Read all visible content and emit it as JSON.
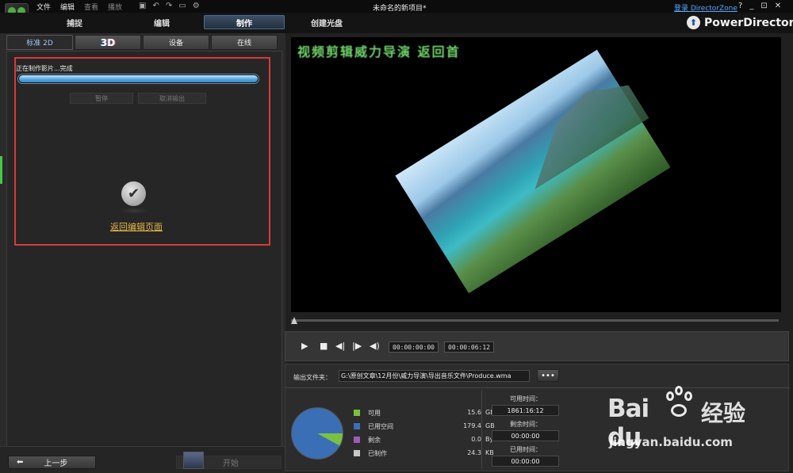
{
  "menu": {
    "items": [
      "文件",
      "编辑",
      "查看",
      "播放"
    ]
  },
  "window": {
    "title": "未命名的新项目*",
    "signin": "登录 DirectorZone",
    "help": "?",
    "minimize": "_",
    "restore": "⊡",
    "close": "✕"
  },
  "modes": {
    "capture": "捕捉",
    "edit": "编辑",
    "produce": "制作",
    "disc": "创建光盘"
  },
  "brand": {
    "name": "PowerDirector"
  },
  "subtabs": {
    "standard2d": "标准 2D",
    "threed": "3D",
    "device": "设备",
    "online": "在线"
  },
  "produce": {
    "status": "正在制作影片...完成",
    "progress": 1.0,
    "pause": "暂停",
    "cancel": "取消输出",
    "return_link": "返回编辑页面"
  },
  "nav": {
    "prev": "上一步",
    "start": "开始"
  },
  "preview": {
    "caption": "视频剪辑威力导演 返回首"
  },
  "player": {
    "current_time": "00:00:00:00",
    "duration": "00:00:06:12"
  },
  "output": {
    "folder_label": "输出文件夹：",
    "folder_path": "G:\\原创文章\\12月份\\威力导演\\导出音乐文件\\Produce.wma",
    "browse": "•••",
    "disk": [
      {
        "label": "可用",
        "value": "15.6",
        "unit": "GB",
        "color": "#7bc043"
      },
      {
        "label": "已用空间",
        "value": "179.4",
        "unit": "GB",
        "color": "#3a6fb5"
      },
      {
        "label": "剩余",
        "value": "0.0",
        "unit": "Byte",
        "color": "#a05ab8"
      },
      {
        "label": "已制作",
        "value": "24.3",
        "unit": "KB",
        "color": "#c8c8c8"
      }
    ],
    "available_time_label": "可用时间：",
    "available_time": "1861:16:12",
    "remaining_time_label": "剩余时间：",
    "remaining_time": "00:00:00",
    "used_time_label": "已用时间：",
    "used_time": "00:00:00"
  },
  "watermark": {
    "brand": "Bai  du",
    "jingyan": "经验",
    "url": "jingyan.baidu.com"
  }
}
